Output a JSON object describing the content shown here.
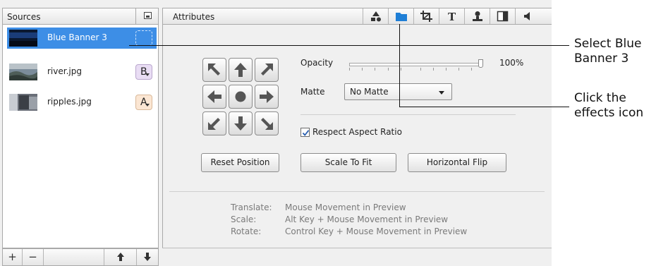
{
  "sources": {
    "title": "Sources",
    "items": [
      {
        "label": "Blue Banner 3",
        "badge": "",
        "selected": true
      },
      {
        "label": "river.jpg",
        "badge": "B",
        "selected": false
      },
      {
        "label": "ripples.jpg",
        "badge": "A",
        "selected": false
      }
    ],
    "footer": {
      "add": "+",
      "remove": "−",
      "up": "🡅",
      "down": "🡇"
    }
  },
  "attributes": {
    "title": "Attributes",
    "tabs": [
      "shapes-icon",
      "effects-icon",
      "crop-icon",
      "text-icon",
      "person-icon",
      "split-icon",
      "audio-icon"
    ],
    "active_tab": "effects-icon",
    "opacity_label": "Opacity",
    "opacity_value": "100%",
    "matte_label": "Matte",
    "matte_value": "No Matte",
    "respect_aspect_label": "Respect Aspect Ratio",
    "respect_aspect_checked": true,
    "reset_position": "Reset Position",
    "scale_to_fit": "Scale To Fit",
    "horizontal_flip": "Horizontal Flip",
    "help": [
      {
        "key": "Translate:",
        "value": "Mouse Movement in Preview"
      },
      {
        "key": "Scale:",
        "value": "Alt Key + Mouse Movement in Preview"
      },
      {
        "key": "Rotate:",
        "value": "Control Key + Mouse Movement in Preview"
      }
    ]
  },
  "callouts": {
    "select_line1": "Select Blue",
    "select_line2": "Banner 3",
    "effects_line1": "Click the",
    "effects_line2": "effects icon"
  },
  "colors": {
    "selection": "#3d8ee6",
    "effects_tab": "#1f7fd6"
  }
}
